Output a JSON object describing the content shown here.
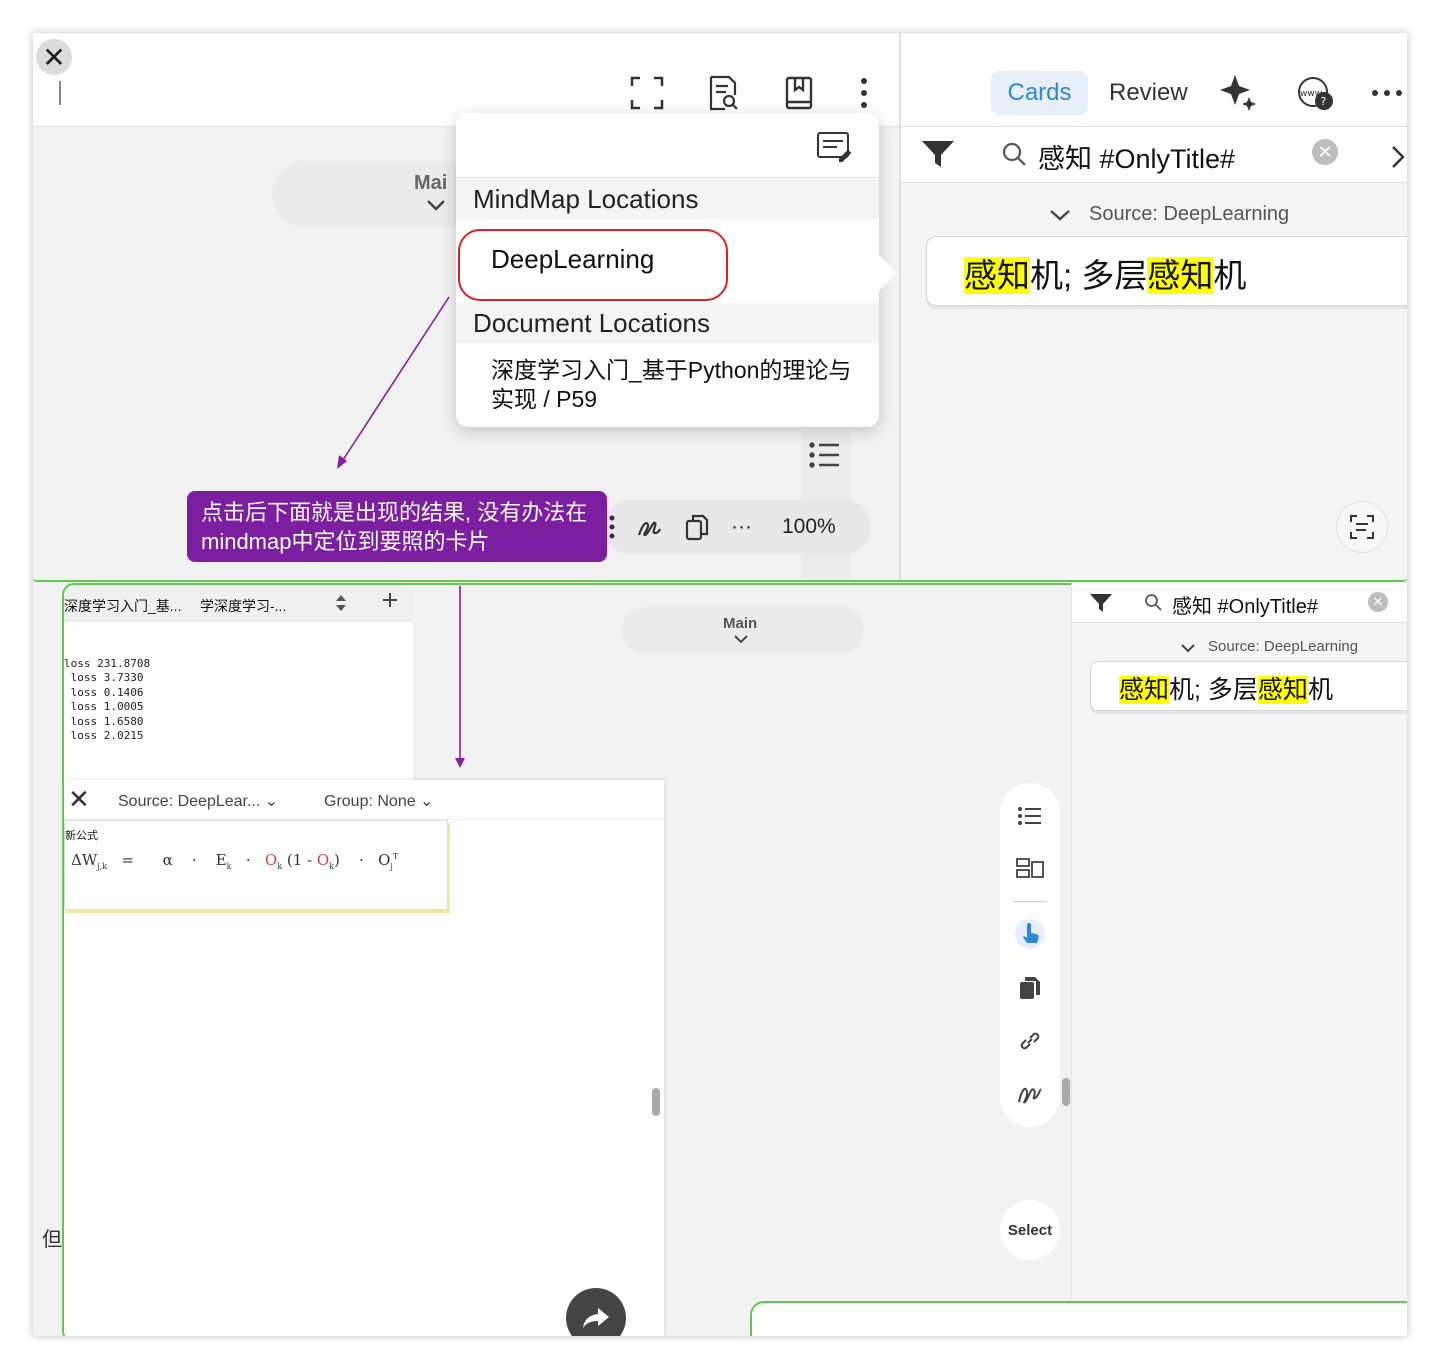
{
  "top": {
    "toolbar_icons": [
      "fullscreen-icon",
      "document-search-icon",
      "book-icon",
      "more-vertical-icon"
    ],
    "main_label": "Mai",
    "popup": {
      "section_mindmap": "MindMap Locations",
      "mindmap_item": "DeepLearning",
      "section_document": "Document Locations",
      "document_item": "深度学习入门_基于Python的理论与实现 / P59"
    },
    "annotation": "点击后下面就是出现的结果, 没有办法在mindmap中定位到要照的卡片",
    "zoom": "100%",
    "more": "···",
    "right": {
      "tab_cards": "Cards",
      "tab_review": "Review",
      "search": "感知 #OnlyTitle#",
      "source": "Source: DeepLearning",
      "card": {
        "pre": "",
        "hl1": "感知",
        "mid": "机; 多层",
        "hl2": "感知",
        "post": "机"
      }
    }
  },
  "bottom": {
    "doc_tabs": [
      "深度学习入门_基...",
      "学深度学习-..."
    ],
    "loss_lines": [
      "loss 231.8708",
      " loss 3.7330",
      " loss 0.1406",
      " loss 1.0005",
      " loss 1.6580",
      " loss 2.0215"
    ],
    "main_label": "Main",
    "float_panel": {
      "source": "Source: DeepLear...",
      "group": "Group: None",
      "card_title": "新公式",
      "formula_parts": [
        "ΔW",
        "j,k",
        "=",
        "α",
        "·",
        "E",
        "k",
        "·",
        "O",
        "k",
        "(1 - ",
        "O",
        "k",
        ")",
        "·",
        "O",
        "j",
        "T"
      ]
    },
    "char_dan": "但",
    "select": "Select",
    "right": {
      "search": "感知 #OnlyTitle#",
      "source": "Source: DeepLearning",
      "card": {
        "hl1": "感知",
        "mid": "机; 多层",
        "hl2": "感知",
        "post": "机"
      }
    }
  },
  "colors": {
    "accent": "#2e87d8",
    "annotation": "#7b1ea0",
    "highlight": "#ffff00",
    "split": "#5ccd4a",
    "oval": "#e02020"
  }
}
